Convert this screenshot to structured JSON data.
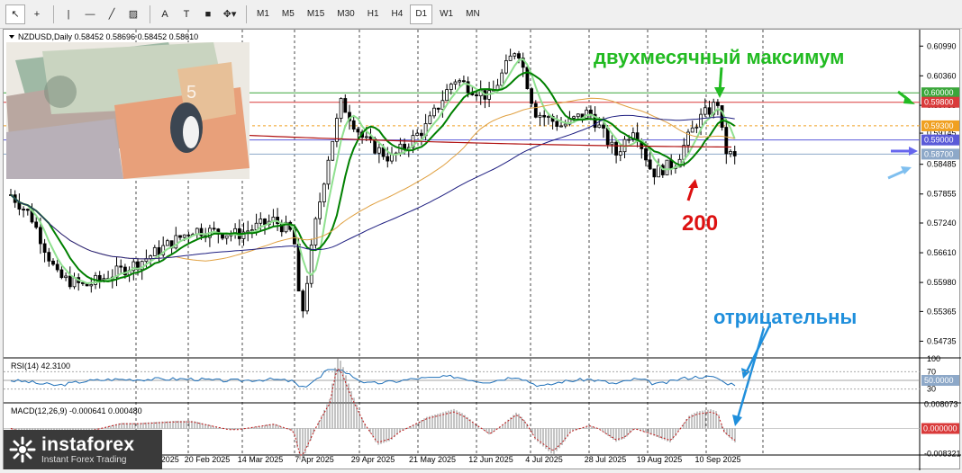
{
  "toolbar": {
    "tools": [
      {
        "name": "cursor-arrow-icon",
        "glyph": "↖"
      },
      {
        "name": "crosshair-icon",
        "glyph": "+"
      },
      {
        "name": "vertical-line-icon",
        "glyph": "|"
      },
      {
        "name": "horizontal-line-icon",
        "glyph": "—"
      },
      {
        "name": "trendline-icon",
        "glyph": "╱"
      },
      {
        "name": "equidistant-channel-icon",
        "glyph": "▨"
      },
      {
        "name": "text-tool-icon",
        "glyph": "A"
      },
      {
        "name": "text-label-icon",
        "glyph": "T"
      },
      {
        "name": "rectangle-icon",
        "glyph": "■"
      },
      {
        "name": "arrows-icon",
        "glyph": "✥▾"
      }
    ],
    "timeframes": [
      "M1",
      "M5",
      "M15",
      "M30",
      "H1",
      "H4",
      "D1",
      "W1",
      "MN"
    ],
    "active_timeframe": "D1"
  },
  "chart": {
    "header": "NZDUSD,Daily  0.58452 0.58696 0.58452 0.58610",
    "price_labels": [
      "0.60990",
      "0.60360",
      "0.59735",
      "0.59145",
      "0.58485",
      "0.57855",
      "0.57240",
      "0.56610",
      "0.55980",
      "0.55365",
      "0.54735"
    ],
    "highlighted_levels": [
      {
        "value": "0.60000",
        "color": "#3aa63a",
        "text_color": "#ffffff"
      },
      {
        "value": "0.59800",
        "color": "#d93a3a",
        "text_color": "#ffffff"
      },
      {
        "value": "0.59300",
        "color": "#f0a020",
        "text_color": "#ffffff"
      },
      {
        "value": "0.59000",
        "color": "#5a5ad8",
        "text_color": "#ffffff"
      },
      {
        "value": "0.58700",
        "color": "#8da8c8",
        "text_color": "#ffffff"
      }
    ],
    "dates": [
      "30 Jan 2025",
      "20 Feb 2025",
      "14 Mar 2025",
      "7 Apr 2025",
      "29 Apr 2025",
      "21 May 2025",
      "12 Jun 2025",
      "4 Jul 2025",
      "28 Jul 2025",
      "19 Aug 2025",
      "10 Sep 2025"
    ],
    "annotations": {
      "two_month_high": "двухмесячный максимум",
      "ma200": "200",
      "negative": "отрицательны"
    },
    "colors": {
      "ma_green": "#008000",
      "ma_light_green": "#8fe08f",
      "ma_orange": "#e0a040",
      "ma_red": "#b01010",
      "ma_blue": "#1e1e80",
      "annotation_green": "#22bb22",
      "annotation_red": "#dd1111",
      "annotation_blue": "#1f8fdc"
    }
  },
  "rsi": {
    "label": "RSI(14) 42.3100",
    "levels": [
      "100",
      "70",
      "50.0000",
      "30"
    ]
  },
  "macd": {
    "label": "MACD(12,26,9) -0.000641 0.000480",
    "levels": [
      "0.008073",
      "0.000000",
      "-0.008321"
    ]
  },
  "logo": {
    "brand": "instaforex",
    "tagline": "Instant Forex Trading"
  }
}
